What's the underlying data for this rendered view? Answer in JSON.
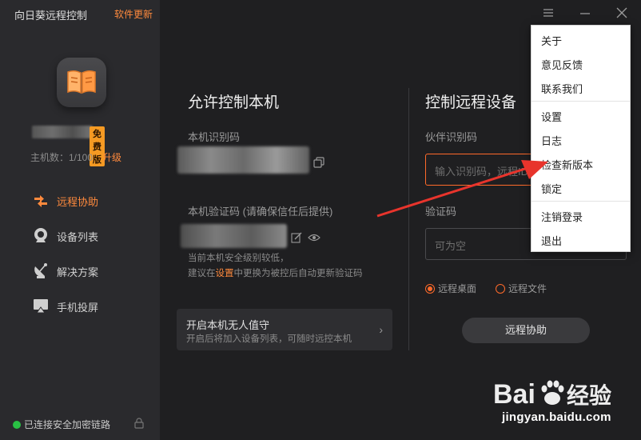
{
  "app": {
    "title": "向日葵远程控制",
    "update_link": "软件更新"
  },
  "user": {
    "edition_badge": "免费版",
    "host_count": "主机数：1/100",
    "upgrade": "升级"
  },
  "sidebar": {
    "items": [
      {
        "label": "远程协助",
        "icon": "remote-assist-icon",
        "active": true
      },
      {
        "label": "设备列表",
        "icon": "device-list-icon",
        "active": false
      },
      {
        "label": "解决方案",
        "icon": "solution-icon",
        "active": false
      },
      {
        "label": "手机投屏",
        "icon": "screen-cast-icon",
        "active": false
      }
    ]
  },
  "status": {
    "text": "已连接安全加密链路",
    "color": "#29c044"
  },
  "allow_control": {
    "title": "允许控制本机",
    "id_label": "本机识别码",
    "code_label": "本机验证码 (请确保信任后提供)",
    "hint_line1": "当前本机安全级别较低，",
    "hint_line2_prefix": "建议在",
    "hint_line2_link": "设置",
    "hint_line2_suffix": "中更换为被控后自动更新验证码",
    "unattended_title": "开启本机无人值守",
    "unattended_desc": "开启后将加入设备列表，可随时远控本机"
  },
  "remote_control": {
    "title": "控制远程设备",
    "partner_label": "伙伴识别码",
    "partner_placeholder": "输入识别码，远程ID",
    "code_label": "验证码",
    "code_placeholder": "可为空",
    "mode_desktop": "远程桌面",
    "mode_file": "远程文件",
    "assist_button": "远程协助"
  },
  "menu": {
    "items": [
      "关于",
      "意见反馈",
      "联系我们",
      "设置",
      "日志",
      "检查新版本",
      "锁定",
      "注销登录",
      "退出"
    ]
  },
  "watermark": {
    "brand": "Bai",
    "brand2": "经验",
    "url": "jingyan.baidu.com"
  },
  "colors": {
    "accent": "#ff8a3d",
    "focus_border": "#ff6a2a",
    "arrow": "#e8342c",
    "badge": "#f59a23"
  }
}
